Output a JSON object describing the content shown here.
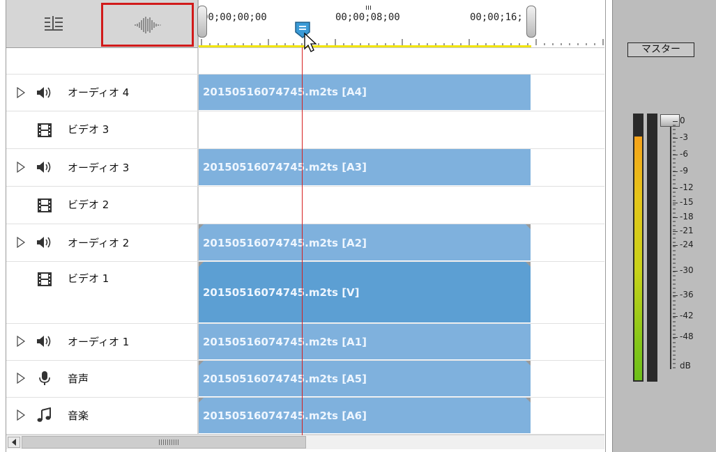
{
  "ruler": {
    "timecodes": [
      "00;00;00;00",
      "00;00;08;00",
      "00;00;16;"
    ]
  },
  "tracks": [
    {
      "name": "オーディオ 4",
      "type": "audio",
      "clip": "20150516074745.m2ts [A4]"
    },
    {
      "name": "ビデオ 3",
      "type": "video",
      "clip": ""
    },
    {
      "name": "オーディオ 3",
      "type": "audio",
      "clip": "20150516074745.m2ts [A3]"
    },
    {
      "name": "ビデオ 2",
      "type": "video",
      "clip": ""
    },
    {
      "name": "オーディオ 2",
      "type": "audio",
      "clip": "20150516074745.m2ts [A2]"
    },
    {
      "name": "ビデオ 1",
      "type": "video",
      "clip": "20150516074745.m2ts [V]"
    },
    {
      "name": "オーディオ 1",
      "type": "audio",
      "clip": "20150516074745.m2ts [A1]"
    },
    {
      "name": "音声",
      "type": "voice",
      "clip": "20150516074745.m2ts [A5]"
    },
    {
      "name": "音楽",
      "type": "music",
      "clip": "20150516074745.m2ts [A6]"
    }
  ],
  "master": {
    "label": "マスター",
    "db_marks": [
      "0",
      "-3",
      "-6",
      "-9",
      "-12",
      "-15",
      "-18",
      "-21",
      "-24",
      "-30",
      "-36",
      "-42",
      "-48",
      "dB"
    ]
  },
  "colors": {
    "selection_outline": "#d11a1a",
    "playhead": "#d62020",
    "audio_clip": "#7fb1dd",
    "video_clip": "#5c9fd3",
    "ruler_range": "#f2e50a"
  },
  "icons": {
    "track_settings": "track-settings-icon",
    "waveform": "waveform-icon",
    "expand": "expand-triangle-icon",
    "speaker": "speaker-icon",
    "film": "film-icon",
    "microphone": "microphone-icon",
    "music": "music-note-icon"
  }
}
